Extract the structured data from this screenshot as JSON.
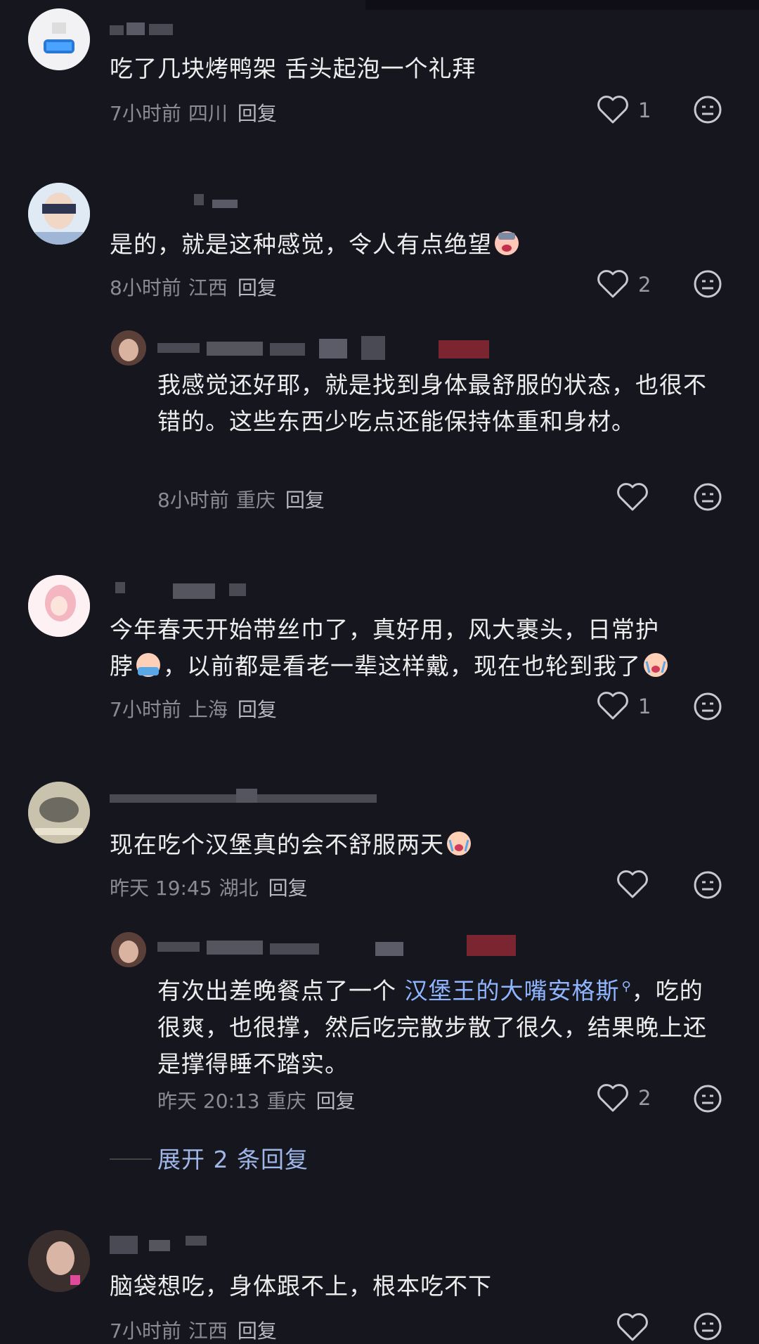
{
  "comments": [
    {
      "text": "吃了几块烤鸭架 舌头起泡一个礼拜",
      "time": "7小时前",
      "location": "四川",
      "reply": "回复",
      "likes": "1"
    },
    {
      "text": "是的，就是这种感觉，令人有点绝望",
      "time": "8小时前",
      "location": "江西",
      "reply": "回复",
      "likes": "2"
    },
    {
      "text": "我感觉还好耶，就是找到身体最舒服的状态，也很不错的。这些东西少吃点还能保持体重和身材。",
      "time": "8小时前",
      "location": "重庆",
      "reply": "回复",
      "likes": ""
    },
    {
      "text1": "今年春天开始带丝巾了，真好用，风大裹头，日常护",
      "text2a": "脖",
      "text2b": "，以前都是看老一辈这样戴，现在也轮到我了",
      "time": "7小时前",
      "location": "上海",
      "reply": "回复",
      "likes": "1"
    },
    {
      "text": "现在吃个汉堡真的会不舒服两天",
      "time": "昨天 19:45",
      "location": "湖北",
      "reply": "回复",
      "likes": ""
    },
    {
      "text_pre": "有次出差晚餐点了一个 ",
      "link": "汉堡王的大嘴安格斯",
      "text_post": "，吃的很爽，也很撑，然后吃完散步散了很久，结果晚上还是撑得睡不踏实。",
      "time": "昨天 20:13",
      "location": "重庆",
      "reply": "回复",
      "likes": "2"
    },
    {
      "text": "脑袋想吃，身体跟不上，根本吃不下",
      "time": "7小时前",
      "location": "江西",
      "reply": "回复",
      "likes": ""
    }
  ],
  "expand_replies": "展开 2 条回复",
  "icons": {
    "like": "heart-outline-icon",
    "emoji": "emoji-face-icon",
    "search": "search-icon"
  },
  "colors": {
    "background": "#16161f",
    "link": "#8fb5ff",
    "meta": "#8b8b95"
  }
}
